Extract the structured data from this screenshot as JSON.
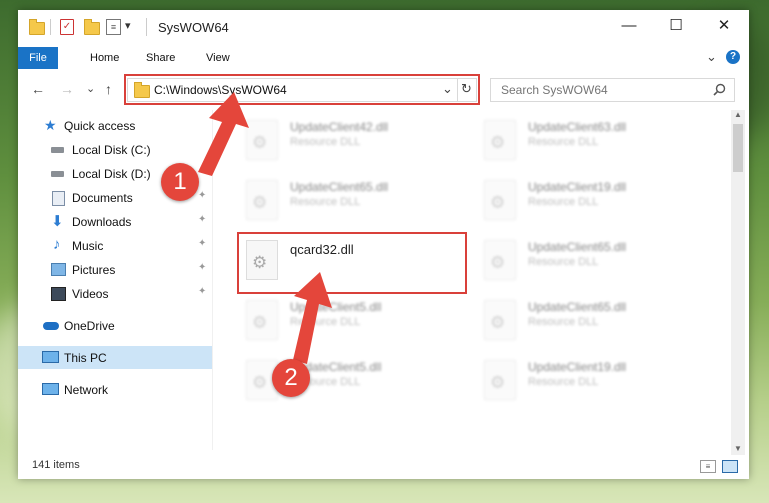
{
  "window": {
    "title": "SysWOW64",
    "controls": {
      "minimize": "—",
      "maximize": "☐",
      "close": "✕"
    }
  },
  "ribbon": {
    "tabs": [
      "File",
      "Home",
      "Share",
      "View"
    ],
    "expand_glyph": "⌄",
    "help_glyph": "?"
  },
  "navigation": {
    "back": "←",
    "forward": "→",
    "recent": "⌄",
    "up": "↑",
    "address": "C:\\Windows\\SysWOW64",
    "address_dropdown": "⌄",
    "refresh": "↻",
    "search_placeholder": "Search SysWOW64",
    "search_icon": "search-icon"
  },
  "sidebar": {
    "items": [
      {
        "label": "Quick access",
        "icon": "star-icon",
        "pinned": false
      },
      {
        "label": "Local Disk (C:)",
        "icon": "drive-icon",
        "pinned": false
      },
      {
        "label": "Local Disk (D:)",
        "icon": "drive-icon",
        "pinned": false
      },
      {
        "label": "Documents",
        "icon": "documents-icon",
        "pinned": true
      },
      {
        "label": "Downloads",
        "icon": "download-icon",
        "pinned": true
      },
      {
        "label": "Music",
        "icon": "music-icon",
        "pinned": true
      },
      {
        "label": "Pictures",
        "icon": "pictures-icon",
        "pinned": true
      },
      {
        "label": "Videos",
        "icon": "videos-icon",
        "pinned": true
      },
      {
        "label": "OneDrive",
        "icon": "cloud-icon",
        "pinned": false
      },
      {
        "label": "This PC",
        "icon": "computer-icon",
        "pinned": false,
        "selected": true
      },
      {
        "label": "Network",
        "icon": "network-icon",
        "pinned": false
      }
    ],
    "pin_glyph": "📌"
  },
  "files": [
    {
      "name": "UpdateClient42.dll",
      "type": "Resource DLL",
      "faded": true
    },
    {
      "name": "UpdateClient63.dll",
      "type": "Resource DLL",
      "faded": true
    },
    {
      "name": "UpdateClient65.dll",
      "type": "Resource DLL",
      "faded": true
    },
    {
      "name": "UpdateClient19.dll",
      "type": "Resource DLL",
      "faded": true
    },
    {
      "name": "qcard32.dll",
      "type": "",
      "faded": false,
      "highlighted": true
    },
    {
      "name": "UpdateClient65.dll",
      "type": "Resource DLL",
      "faded": true
    },
    {
      "name": "UpdateClient5.dll",
      "type": "Resource DLL",
      "faded": true
    },
    {
      "name": "UpdateClient65.dll",
      "type": "Resource DLL",
      "faded": true
    },
    {
      "name": "UpdateClient5.dll",
      "type": "Resource DLL",
      "faded": true
    },
    {
      "name": "UpdateClient19.dll",
      "type": "Resource DLL",
      "faded": true
    }
  ],
  "status": {
    "item_count": "141 items"
  },
  "callouts": [
    {
      "number": "1",
      "target": "address-bar"
    },
    {
      "number": "2",
      "target": "file-qcard32"
    }
  ],
  "colors": {
    "accent": "#1a73c6",
    "callout": "#e4463b",
    "selection": "#cce4f7"
  }
}
